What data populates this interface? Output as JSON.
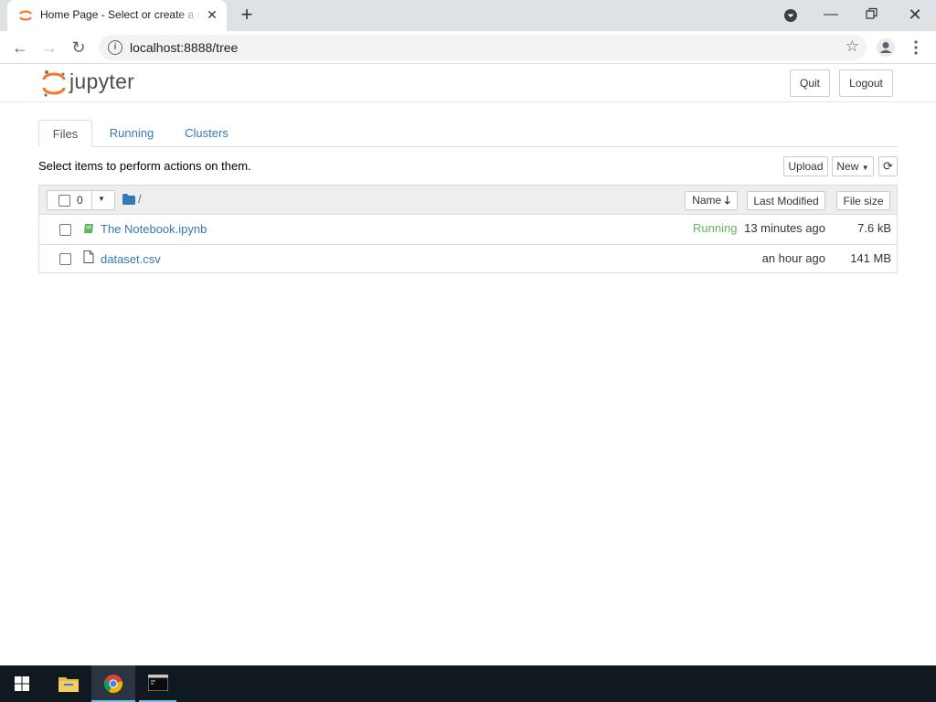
{
  "browser": {
    "tab_title": "Home Page - Select or create a notebook",
    "url": "localhost:8888/tree"
  },
  "header": {
    "logo_text": "jupyter",
    "quit_label": "Quit",
    "logout_label": "Logout"
  },
  "tabs": [
    {
      "label": "Files",
      "active": true
    },
    {
      "label": "Running",
      "active": false
    },
    {
      "label": "Clusters",
      "active": false
    }
  ],
  "hint": "Select items to perform actions on them.",
  "actions": {
    "upload_label": "Upload",
    "new_label": "New"
  },
  "list_header": {
    "selected_count": "0",
    "breadcrumb": "/",
    "name_label": "Name",
    "last_modified_label": "Last Modified",
    "file_size_label": "File size"
  },
  "files": [
    {
      "name": "The Notebook.ipynb",
      "type": "notebook",
      "status": "Running",
      "modified": "13 minutes ago",
      "size": "7.6 kB"
    },
    {
      "name": "dataset.csv",
      "type": "file",
      "status": "",
      "modified": "an hour ago",
      "size": "141 MB"
    }
  ],
  "colors": {
    "link": "#337ab7",
    "running": "#5cb85c",
    "jupyter_orange": "#f37726",
    "taskbar": "#101820"
  }
}
